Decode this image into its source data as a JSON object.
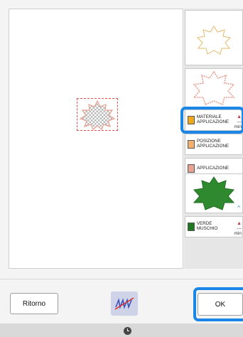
{
  "canvas": {
    "preview_name": "appliqué-design-preview"
  },
  "side_panel": {
    "thumbnails": [
      {
        "name": "thumb-material-outline",
        "color": "#e8b86a"
      },
      {
        "name": "thumb-placement-stitch",
        "color": "#e8a090"
      },
      {
        "name": "thumb-green-fill",
        "color": "#2f8a2f"
      }
    ],
    "rows": [
      {
        "label_line1": "MATERIALE",
        "label_line2": "APPLICAZIONE",
        "swatch": "#f0a81c",
        "extra_line1": "---",
        "extra_line2": "min",
        "extra_icon": "no-sew-icon"
      },
      {
        "label_line1": "POSIZIONE",
        "label_line2": "APPLICAZIONE",
        "swatch": "#f5b070",
        "extra_line1": "",
        "extra_line2": "",
        "extra_icon": ""
      },
      {
        "label_line1": "APPLICAZIONE",
        "label_line2": "",
        "swatch": "#e8a090",
        "extra_line1": "",
        "extra_line2": "",
        "extra_icon": ""
      },
      {
        "label_line1": "VERDE",
        "label_line2": "MUSCHIO",
        "swatch": "#1f7a1f",
        "extra_line1": "---",
        "extra_line2": "min",
        "extra_icon": "no-sew-icon"
      }
    ]
  },
  "bottom": {
    "back_label": "Ritorno",
    "ok_label": "OK",
    "middle_icon": "no-sew-icon"
  },
  "colors": {
    "highlight": "#1a86e8"
  }
}
